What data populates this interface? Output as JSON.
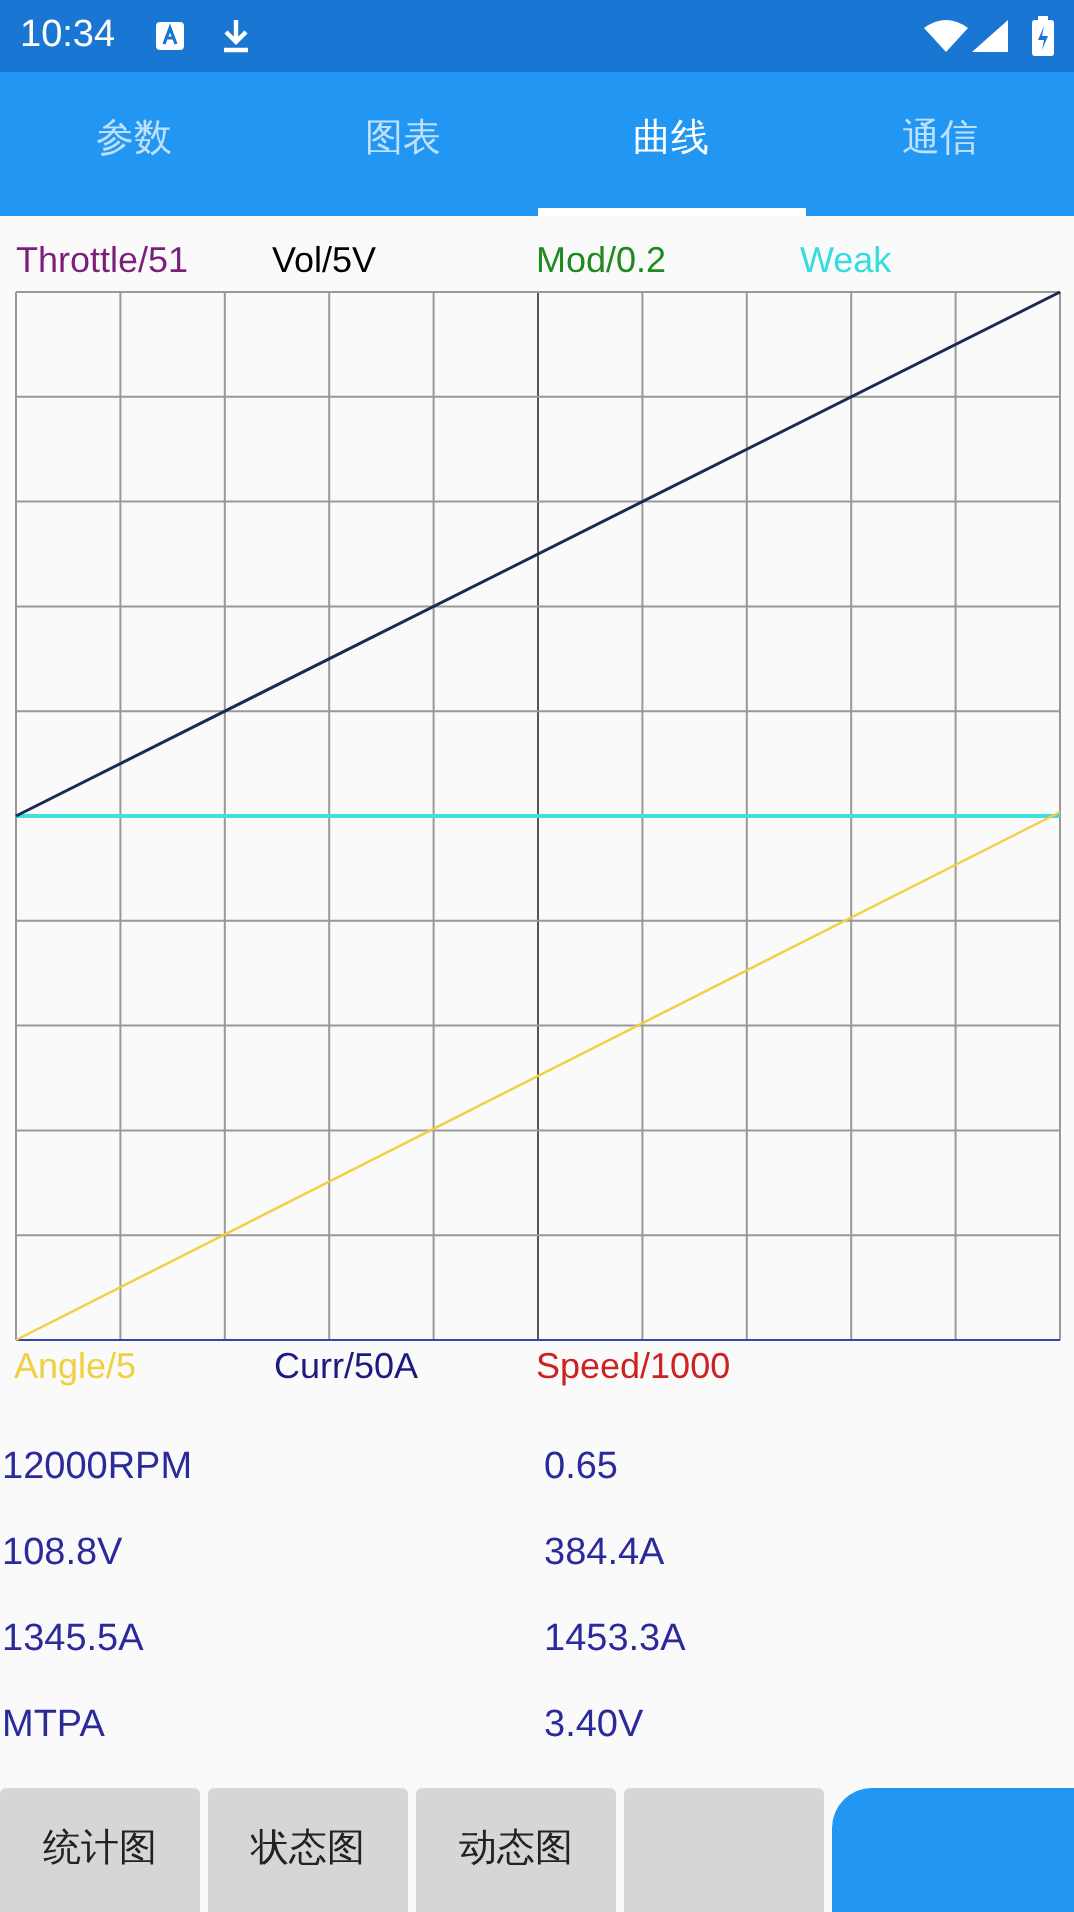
{
  "status_bar": {
    "time": "10:34"
  },
  "tabs": [
    {
      "label": "参数",
      "selected": false
    },
    {
      "label": "图表",
      "selected": false
    },
    {
      "label": "曲线",
      "selected": true
    },
    {
      "label": "通信",
      "selected": false
    }
  ],
  "legend_top": [
    {
      "label": "Throttle/51",
      "color": "#7b1f7b"
    },
    {
      "label": "Vol/5V",
      "color": "#000000"
    },
    {
      "label": "Mod/0.2",
      "color": "#1f8a1f"
    },
    {
      "label": "Weak",
      "color": "#33dddd"
    }
  ],
  "legend_bottom": [
    {
      "label": "Angle/5",
      "color": "#f0d040"
    },
    {
      "label": "Curr/50A",
      "color": "#1a1a80"
    },
    {
      "label": "Speed/1000",
      "color": "#cc2222"
    }
  ],
  "readings": [
    [
      "12000RPM",
      "0.65"
    ],
    [
      "108.8V",
      "384.4A"
    ],
    [
      "1345.5A",
      "1453.3A"
    ],
    [
      "MTPA",
      "3.40V"
    ]
  ],
  "buttons": [
    {
      "kind": "plain",
      "label": "统计图"
    },
    {
      "kind": "plain",
      "label": "状态图"
    },
    {
      "kind": "plain",
      "label": "动态图"
    },
    {
      "kind": "plain"
    },
    {
      "kind": "primary"
    }
  ]
}
